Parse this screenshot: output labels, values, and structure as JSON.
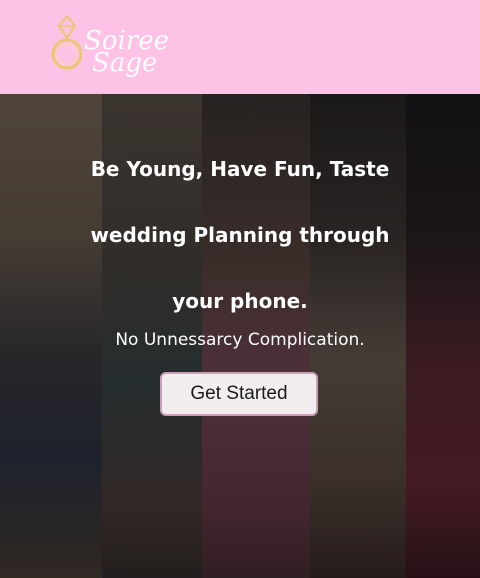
{
  "brand": {
    "logo_line1": "Soiree",
    "logo_line2": "Sage",
    "icon": "ring-icon",
    "header_color": "#fdc2e6"
  },
  "hero": {
    "headline": "Be Young, Have Fun, Taste wedding Planning through your phone.",
    "tagline": "No Unnessarcy Complication.",
    "cta_label": "Get Started"
  }
}
